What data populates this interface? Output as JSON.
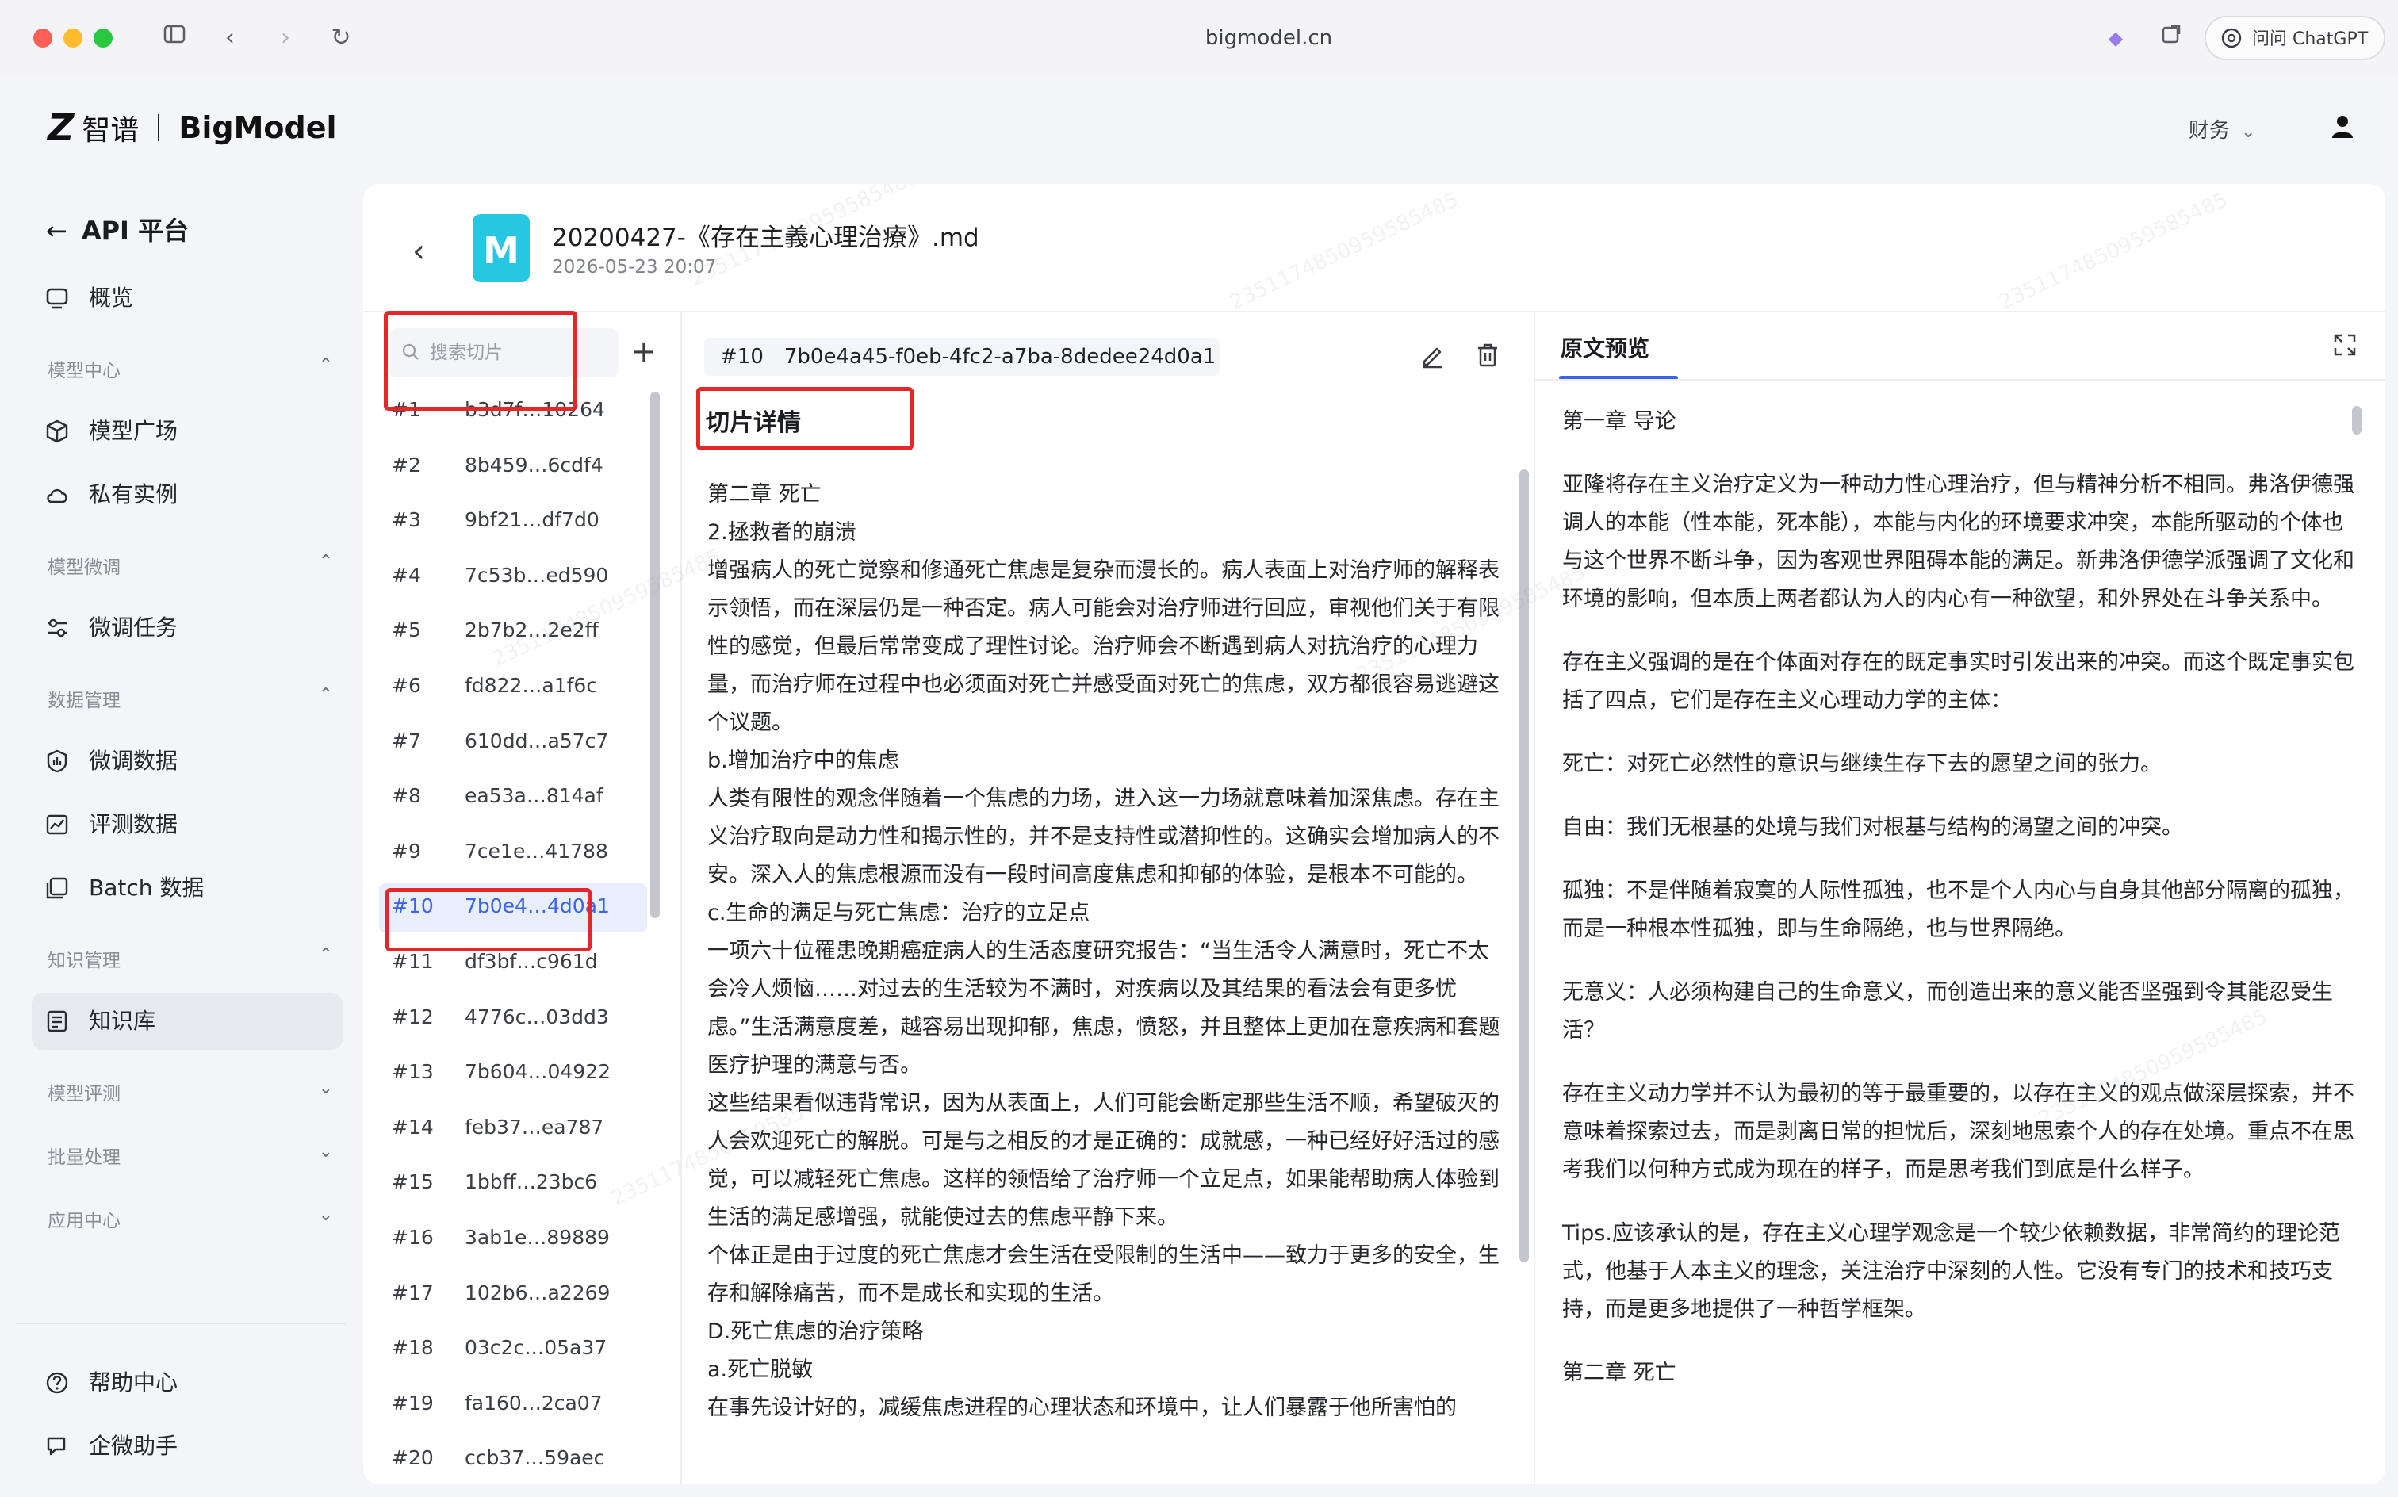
{
  "browser": {
    "url": "bigmodel.cn",
    "ask_button": "问问 ChatGPT"
  },
  "header": {
    "logo_cn": "智谱",
    "logo_en": "BigModel",
    "finance_label": "财务"
  },
  "sidebar": {
    "title": "API 平台",
    "overview": "概览",
    "sections": {
      "model_center": "模型中心",
      "model_finetune": "模型微调",
      "data_mgmt": "数据管理",
      "knowledge_mgmt": "知识管理",
      "model_eval": "模型评测",
      "batch": "批量处理",
      "app_center": "应用中心"
    },
    "items": {
      "model_square": "模型广场",
      "private_instance": "私有实例",
      "finetune_task": "微调任务",
      "finetune_data": "微调数据",
      "eval_data": "评测数据",
      "batch_data": "Batch 数据",
      "knowledge_base": "知识库"
    },
    "help": "帮助中心",
    "assistant": "企微助手"
  },
  "file": {
    "badge": "M",
    "title": "20200427-《存在主義心理治療》.md",
    "date": "2026-05-23 20:07"
  },
  "search": {
    "placeholder": "搜索切片"
  },
  "slices": [
    {
      "num": "#1",
      "hash": "b3d7f…10264"
    },
    {
      "num": "#2",
      "hash": "8b459…6cdf4"
    },
    {
      "num": "#3",
      "hash": "9bf21…df7d0"
    },
    {
      "num": "#4",
      "hash": "7c53b…ed590"
    },
    {
      "num": "#5",
      "hash": "2b7b2…2e2ff"
    },
    {
      "num": "#6",
      "hash": "fd822…a1f6c"
    },
    {
      "num": "#7",
      "hash": "610dd…a57c7"
    },
    {
      "num": "#8",
      "hash": "ea53a…814af"
    },
    {
      "num": "#9",
      "hash": "7ce1e…41788"
    },
    {
      "num": "#10",
      "hash": "7b0e4…4d0a1"
    },
    {
      "num": "#11",
      "hash": "df3bf…c961d"
    },
    {
      "num": "#12",
      "hash": "4776c…03dd3"
    },
    {
      "num": "#13",
      "hash": "7b604…04922"
    },
    {
      "num": "#14",
      "hash": "feb37…ea787"
    },
    {
      "num": "#15",
      "hash": "1bbff…23bc6"
    },
    {
      "num": "#16",
      "hash": "3ab1e…89889"
    },
    {
      "num": "#17",
      "hash": "102b6…a2269"
    },
    {
      "num": "#18",
      "hash": "03c2c…05a37"
    },
    {
      "num": "#19",
      "hash": "fa160…2ca07"
    },
    {
      "num": "#20",
      "hash": "ccb37…59aec"
    }
  ],
  "detail": {
    "slice_num": "#10",
    "slice_id": "7b0e4a45-f0eb-4fc2-a7ba-8dedee24d0a1",
    "title": "切片详情",
    "paragraphs": [
      "第二章 死亡",
      "2.拯救者的崩溃",
      "增强病人的死亡觉察和修通死亡焦虑是复杂而漫长的。病人表面上对治疗师的解释表示领悟，而在深层仍是一种否定。病人可能会对治疗师进行回应，审视他们关于有限性的感觉，但最后常常变成了理性讨论。治疗师会不断遇到病人对抗治疗的心理力量，而治疗师在过程中也必须面对死亡并感受面对死亡的焦虑，双方都很容易逃避这个议题。",
      "b.增加治疗中的焦虑",
      "人类有限性的观念伴随着一个焦虑的力场，进入这一力场就意味着加深焦虑。存在主义治疗取向是动力性和揭示性的，并不是支持性或潜抑性的。这确实会增加病人的不安。深入人的焦虑根源而没有一段时间高度焦虑和抑郁的体验，是根本不可能的。",
      "c.生命的满足与死亡焦虑：治疗的立足点",
      "一项六十位罹患晚期癌症病人的生活态度研究报告：“当生活令人满意时，死亡不太会冷人烦恼……对过去的生活较为不满时，对疾病以及其结果的看法会有更多忧虑。”生活满意度差，越容易出现抑郁，焦虑，愤怒，并且整体上更加在意疾病和套题医疗护理的满意与否。",
      "这些结果看似违背常识，因为从表面上，人们可能会断定那些生活不顺，希望破灭的人会欢迎死亡的解脱。可是与之相反的才是正确的：成就感，一种已经好好活过的感觉，可以减轻死亡焦虑。这样的领悟给了治疗师一个立足点，如果能帮助病人体验到生活的满足感增强，就能使过去的焦虑平静下来。",
      "个体正是由于过度的死亡焦虑才会生活在受限制的生活中——致力于更多的安全，生存和解除痛苦，而不是成长和实现的生活。",
      "D.死亡焦虑的治疗策略",
      "a.死亡脱敏",
      "在事先设计好的，减缓焦虑进程的心理状态和环境中，让人们暴露于他所害怕的"
    ]
  },
  "preview": {
    "tab": "原文预览",
    "paragraphs": [
      "第一章 导论",
      "亚隆将存在主义治疗定义为一种动力性心理治疗，但与精神分析不相同。弗洛伊德强调人的本能（性本能，死本能），本能与内化的环境要求冲突，本能所驱动的个体也与这个世界不断斗争，因为客观世界阻碍本能的满足。新弗洛伊德学派强调了文化和环境的影响，但本质上两者都认为人的内心有一种欲望，和外界处在斗争关系中。",
      "存在主义强调的是在个体面对存在的既定事实时引发出来的冲突。而这个既定事实包括了四点，它们是存在主义心理动力学的主体：",
      "死亡：对死亡必然性的意识与继续生存下去的愿望之间的张力。",
      "自由：我们无根基的处境与我们对根基与结构的渴望之间的冲突。",
      "孤独：不是伴随着寂寞的人际性孤独，也不是个人内心与自身其他部分隔离的孤独，而是一种根本性孤独，即与生命隔绝，也与世界隔绝。",
      "无意义：人必须构建自己的生命意义，而创造出来的意义能否坚强到令其能忍受生活？",
      "存在主义动力学并不认为最初的等于最重要的，以存在主义的观点做深层探索，并不意味着探索过去，而是剥离日常的担忧后，深刻地思索个人的存在处境。重点不在思考我们以何种方式成为现在的样子，而是思考我们到底是什么样子。",
      "Tips.应该承认的是，存在主义心理学观念是一个较少依赖数据，非常简约的理论范式，他基于人本主义的理念，关注治疗中深刻的人性。它没有专门的技术和技巧支持，而是更多地提供了一种哲学框架。",
      "第二章 死亡"
    ]
  },
  "colors": {
    "accent": "#3c64e8",
    "annotation_red": "#e5262b",
    "file_badge": "#27c6e2"
  }
}
